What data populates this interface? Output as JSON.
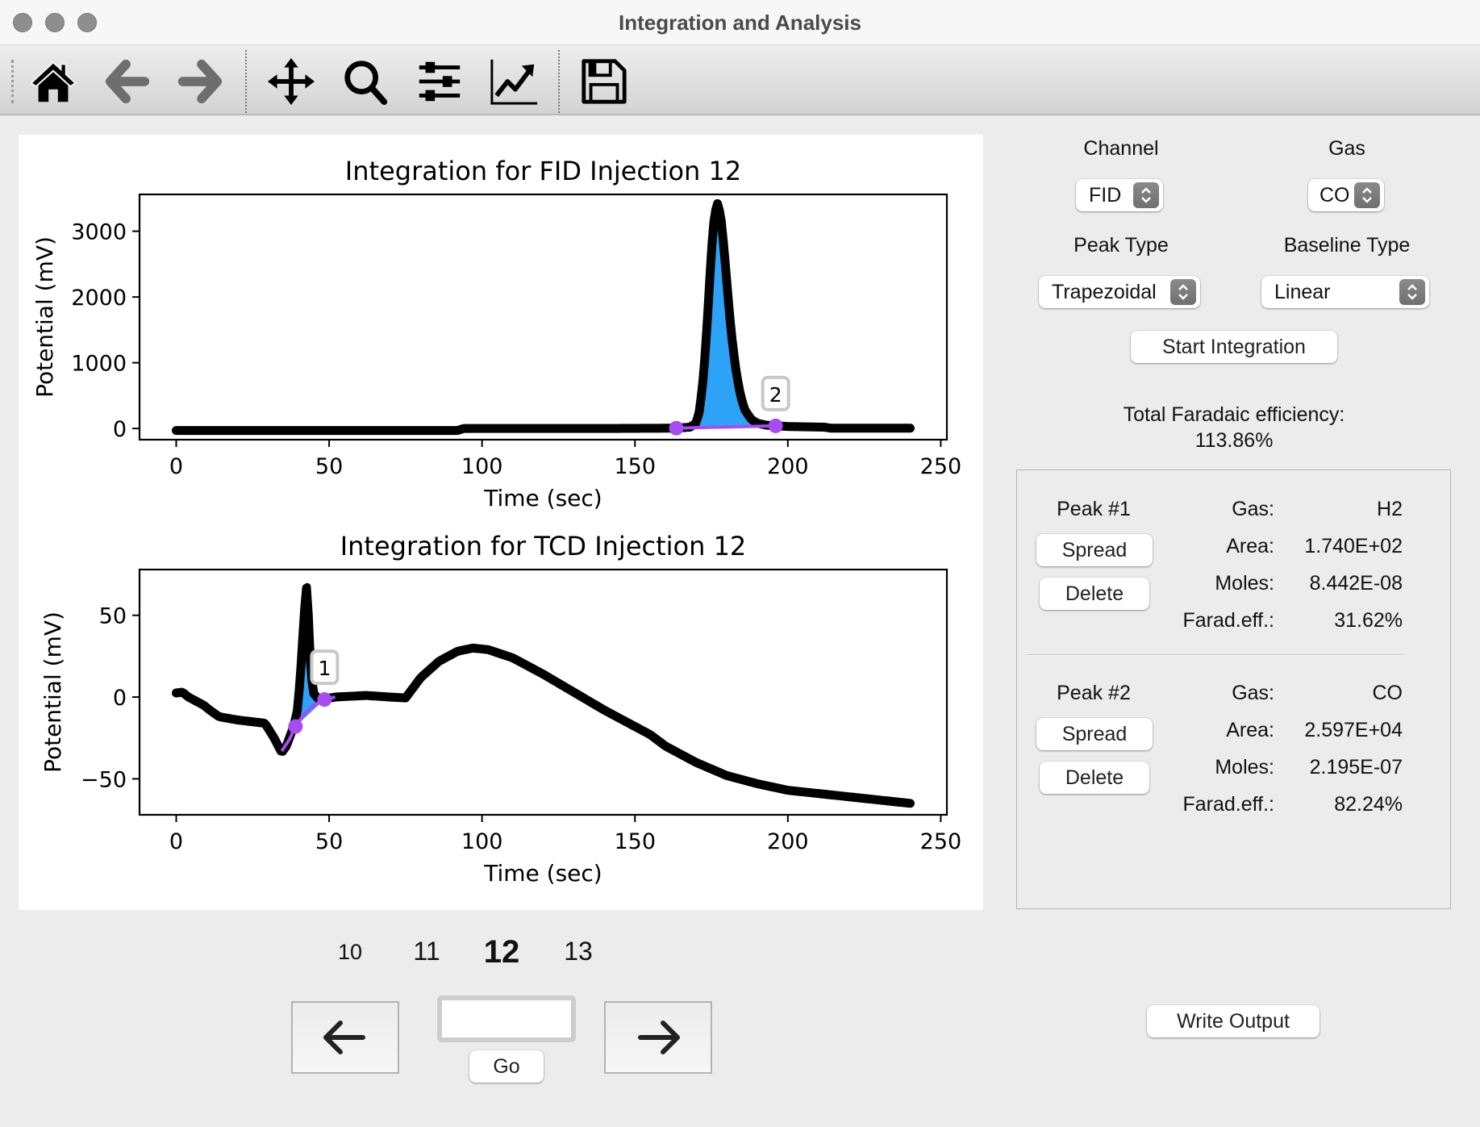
{
  "window": {
    "title": "Integration and Analysis",
    "traffic_lights": [
      "close",
      "minimize",
      "zoom"
    ]
  },
  "toolbar": {
    "buttons": [
      {
        "name": "home",
        "icon": "home-icon"
      },
      {
        "name": "back",
        "icon": "arrow-left-icon"
      },
      {
        "name": "forward",
        "icon": "arrow-right-icon"
      },
      {
        "name": "pan",
        "icon": "move-icon"
      },
      {
        "name": "zoom",
        "icon": "magnifier-icon"
      },
      {
        "name": "subplots",
        "icon": "sliders-icon"
      },
      {
        "name": "axes",
        "icon": "chart-line-icon"
      },
      {
        "name": "save",
        "icon": "floppy-disk-icon"
      }
    ]
  },
  "controls": {
    "channel_label": "Channel",
    "channel_value": "FID",
    "gas_label": "Gas",
    "gas_value": "CO",
    "peak_type_label": "Peak Type",
    "peak_type_value": "Trapezoidal",
    "baseline_type_label": "Baseline Type",
    "baseline_type_value": "Linear",
    "start_integration_label": "Start Integration",
    "total_fe_label": "Total Faradaic efficiency:",
    "total_fe_value": "113.86%"
  },
  "peaks": [
    {
      "title": "Peak #1",
      "spread_label": "Spread",
      "delete_label": "Delete",
      "gas_label": "Gas:",
      "gas": "H2",
      "area_label": "Area:",
      "area": "1.740E+02",
      "moles_label": "Moles:",
      "moles": "8.442E-08",
      "fe_label": "Farad.eff.:",
      "fe": "31.62%"
    },
    {
      "title": "Peak #2",
      "spread_label": "Spread",
      "delete_label": "Delete",
      "gas_label": "Gas:",
      "gas": "CO",
      "area_label": "Area:",
      "area": "2.597E+04",
      "moles_label": "Moles:",
      "moles": "2.195E-07",
      "fe_label": "Farad.eff.:",
      "fe": "82.24%"
    }
  ],
  "navigation": {
    "injections": [
      "10",
      "11",
      "12",
      "13"
    ],
    "current_injection": "12",
    "goto_value": "",
    "go_label": "Go",
    "prev_icon": "arrow-left-icon",
    "next_icon": "arrow-right-icon"
  },
  "output": {
    "write_output_label": "Write Output"
  },
  "colors": {
    "fill": "#2ca3f7",
    "baseline": "#a64cf2",
    "trace": "#000000"
  },
  "chart_data": [
    {
      "type": "line",
      "title": "Integration for FID Injection 12",
      "xlabel": "Time (sec)",
      "ylabel": "Potential (mV)",
      "xlim": [
        -12,
        252
      ],
      "ylim": [
        -170,
        3560
      ],
      "xticks": [
        0,
        50,
        100,
        150,
        200,
        250
      ],
      "yticks": [
        0,
        1000,
        2000,
        3000
      ],
      "grid": false,
      "series": [
        {
          "name": "signal",
          "x": [
            0,
            40,
            92,
            94,
            140,
            163,
            168,
            170,
            171,
            172,
            173,
            174,
            175,
            176,
            177,
            178,
            179,
            180,
            181,
            182,
            183,
            184,
            185,
            186,
            188,
            190,
            193,
            196,
            200,
            212,
            214,
            240
          ],
          "y": [
            -30,
            -30,
            -30,
            0,
            0,
            5,
            20,
            80,
            250,
            600,
            1150,
            1900,
            2700,
            3250,
            3420,
            3250,
            2800,
            2250,
            1700,
            1250,
            900,
            620,
            420,
            280,
            140,
            80,
            50,
            40,
            30,
            20,
            5,
            5
          ]
        }
      ],
      "peak_fill": {
        "x_start": 163.5,
        "x_end": 196,
        "label": "2"
      },
      "baseline_points": [
        {
          "x": 163.5,
          "y": 5
        },
        {
          "x": 196,
          "y": 40
        }
      ]
    },
    {
      "type": "line",
      "title": "Integration for TCD Injection 12",
      "xlabel": "Time (sec)",
      "ylabel": "Potential (mV)",
      "xlim": [
        -12,
        252
      ],
      "ylim": [
        -72,
        78
      ],
      "xticks": [
        0,
        50,
        100,
        150,
        200,
        250
      ],
      "yticks": [
        -50,
        0,
        50
      ],
      "grid": false,
      "series": [
        {
          "name": "signal",
          "x": [
            0,
            2,
            4,
            6,
            9,
            11,
            14,
            20,
            29,
            32,
            34.5,
            36,
            38,
            39.5,
            40.5,
            41.5,
            42.2,
            42.8,
            43.3,
            44,
            45,
            47,
            48.5,
            52,
            62,
            70,
            75,
            80,
            86,
            92,
            97,
            102,
            110,
            120,
            130,
            140,
            150,
            155,
            160,
            170,
            180,
            190,
            200,
            215,
            230,
            240
          ],
          "y": [
            2.5,
            3,
            0,
            -2,
            -5,
            -8,
            -12,
            -14,
            -16,
            -25,
            -34,
            -30,
            -20,
            -10,
            10,
            40,
            60,
            70,
            45,
            15,
            2,
            -2,
            -1,
            0,
            1,
            0,
            -0.5,
            12,
            22,
            28,
            30,
            29,
            24,
            14,
            3,
            -8,
            -18,
            -23,
            -30,
            -40,
            -48,
            -53,
            -57,
            -60,
            -63,
            -65
          ]
        }
      ],
      "peak_fill": {
        "x_start": 39,
        "x_end": 48.5,
        "label": "1"
      },
      "baseline_points": [
        {
          "x": 39,
          "y": -18
        },
        {
          "x": 48.5,
          "y": -1.5
        }
      ],
      "baseline_curve": {
        "x": [
          34.5,
          37,
          39,
          42,
          45,
          48.5,
          52
        ],
        "y": [
          -33,
          -26,
          -18,
          -10,
          -5,
          -1.5,
          0
        ]
      }
    }
  ]
}
